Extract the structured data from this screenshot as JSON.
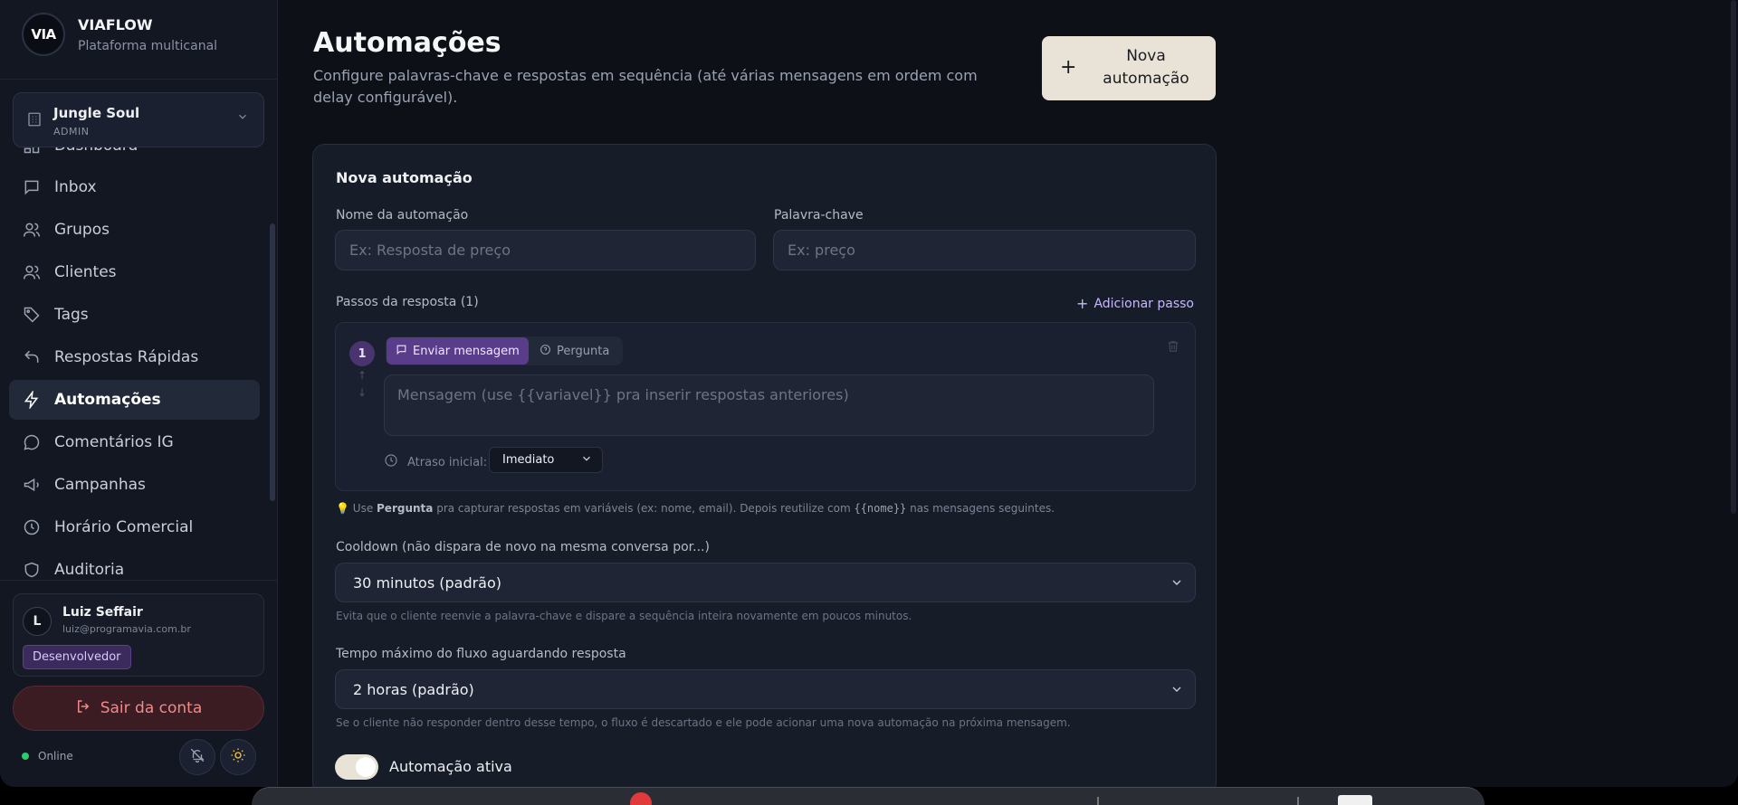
{
  "brand": {
    "logo": "VIA",
    "name": "VIAFLOW",
    "subtitle": "Plataforma multicanal"
  },
  "workspace": {
    "name": "Jungle Soul",
    "role": "ADMIN"
  },
  "nav": {
    "items": [
      {
        "label": "Dashboard",
        "icon": "dashboard-icon"
      },
      {
        "label": "Inbox",
        "icon": "message-icon"
      },
      {
        "label": "Grupos",
        "icon": "users-icon"
      },
      {
        "label": "Clientes",
        "icon": "users-icon"
      },
      {
        "label": "Tags",
        "icon": "tag-icon"
      },
      {
        "label": "Respostas Rápidas",
        "icon": "reply-icon"
      },
      {
        "label": "Automações",
        "icon": "bolt-icon",
        "active": true
      },
      {
        "label": "Comentários IG",
        "icon": "comment-icon"
      },
      {
        "label": "Campanhas",
        "icon": "megaphone-icon"
      },
      {
        "label": "Horário Comercial",
        "icon": "clock-icon"
      },
      {
        "label": "Auditoria",
        "icon": "shield-icon"
      }
    ]
  },
  "user": {
    "initial": "L",
    "name": "Luiz Seffair",
    "email": "luiz@programavia.com.br",
    "badge": "Desenvolvedor"
  },
  "logout_label": "Sair da conta",
  "status_label": "Online",
  "page": {
    "title": "Automações",
    "description": "Configure palavras-chave e respostas em sequência (até várias mensagens em ordem com delay configurável).",
    "new_button": "Nova automação"
  },
  "form": {
    "title": "Nova automação",
    "name_label": "Nome da automação",
    "name_placeholder": "Ex: Resposta de preço",
    "keyword_label": "Palavra-chave",
    "keyword_placeholder": "Ex: preço",
    "steps_label": "Passos da resposta (1)",
    "add_step": "Adicionar passo",
    "step": {
      "number": "1",
      "send_tab": "Enviar mensagem",
      "question_tab": "Pergunta",
      "message_placeholder": "Mensagem (use {{variavel}} pra inserir respostas anteriores)",
      "delay_label": "Atraso inicial:",
      "delay_value": "Imediato"
    },
    "hint": {
      "pre": "Use ",
      "bold": "Pergunta",
      "mid": " pra capturar respostas em variáveis (ex: nome, email). Depois reutilize com ",
      "code": "{{nome}}",
      "post": " nas mensagens seguintes."
    },
    "cooldown_label": "Cooldown (não dispara de novo na mesma conversa por...)",
    "cooldown_value": "30 minutos (padrão)",
    "cooldown_note": "Evita que o cliente reenvie a palavra-chave e dispare a sequência inteira novamente em poucos minutos.",
    "timeout_label": "Tempo máximo do fluxo aguardando resposta",
    "timeout_value": "2 horas (padrão)",
    "timeout_note": "Se o cliente não responder dentro desse tempo, o fluxo é descartado e ele pode acionar uma nova automação na próxima mensagem.",
    "active_label": "Automação ativa",
    "active": true
  },
  "colors": {
    "accent": "#5a3d8a",
    "primary_button": "#e9e2d6",
    "danger": "#f28a8a",
    "online": "#2ecc71"
  }
}
